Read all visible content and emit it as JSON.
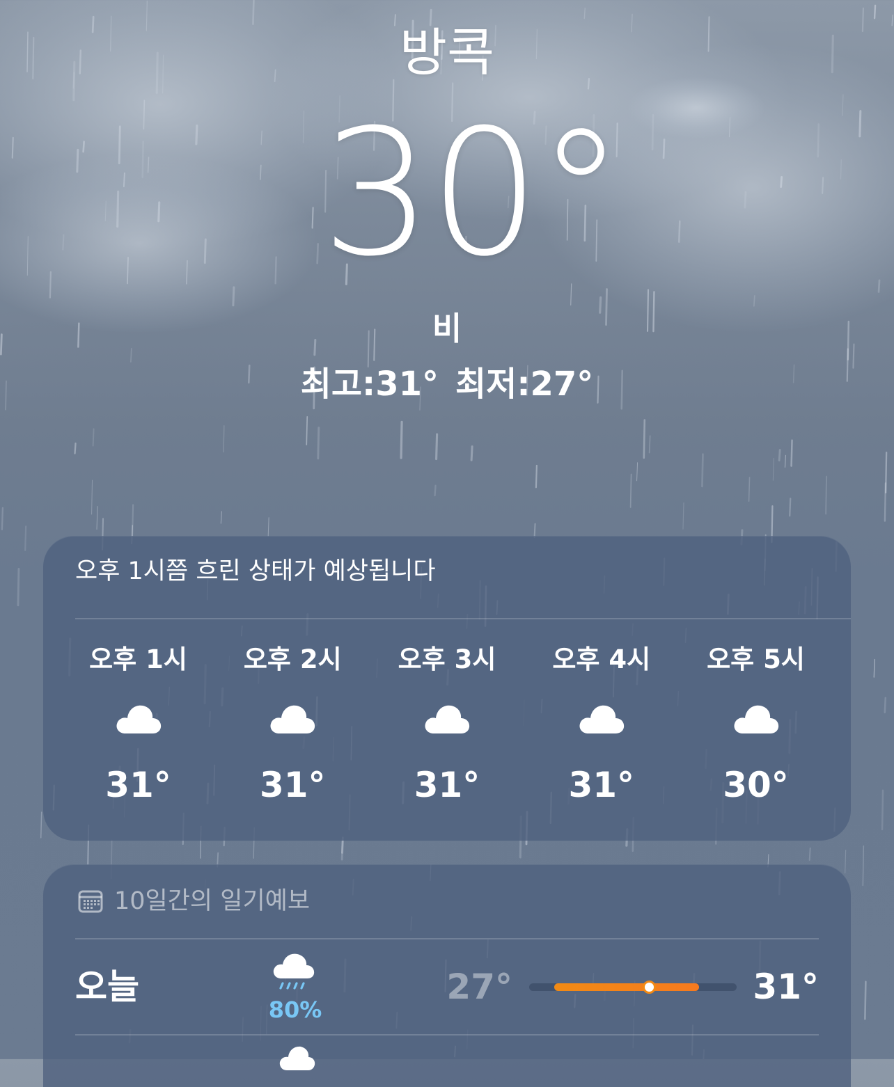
{
  "current": {
    "city": "방콕",
    "temperature": "30°",
    "condition": "비",
    "high": "최고:31°",
    "low": "최저:27°"
  },
  "hourly": {
    "summary": "오후 1시쯤 흐린 상태가 예상됩니다",
    "hours": [
      {
        "label": "오후 1시",
        "icon": "cloud-icon",
        "temp": "31°"
      },
      {
        "label": "오후 2시",
        "icon": "cloud-icon",
        "temp": "31°"
      },
      {
        "label": "오후 3시",
        "icon": "cloud-icon",
        "temp": "31°"
      },
      {
        "label": "오후 4시",
        "icon": "cloud-icon",
        "temp": "31°"
      },
      {
        "label": "오후 5시",
        "icon": "cloud-icon",
        "temp": "30°"
      }
    ]
  },
  "daily": {
    "title": "10일간의 일기예보",
    "icon": "calendar-icon",
    "days": [
      {
        "name": "오늘",
        "icon": "cloud-rain-icon",
        "precip": "80%",
        "low": "27°",
        "high": "31°",
        "range_fill_start": 0.12,
        "range_fill_end": 0.82,
        "current_marker": 0.58
      }
    ],
    "next_icon": "cloud-icon"
  },
  "colors": {
    "range_bar": "#f28a14",
    "precip_text": "#79c7f5",
    "card_background": "#4e607e"
  }
}
